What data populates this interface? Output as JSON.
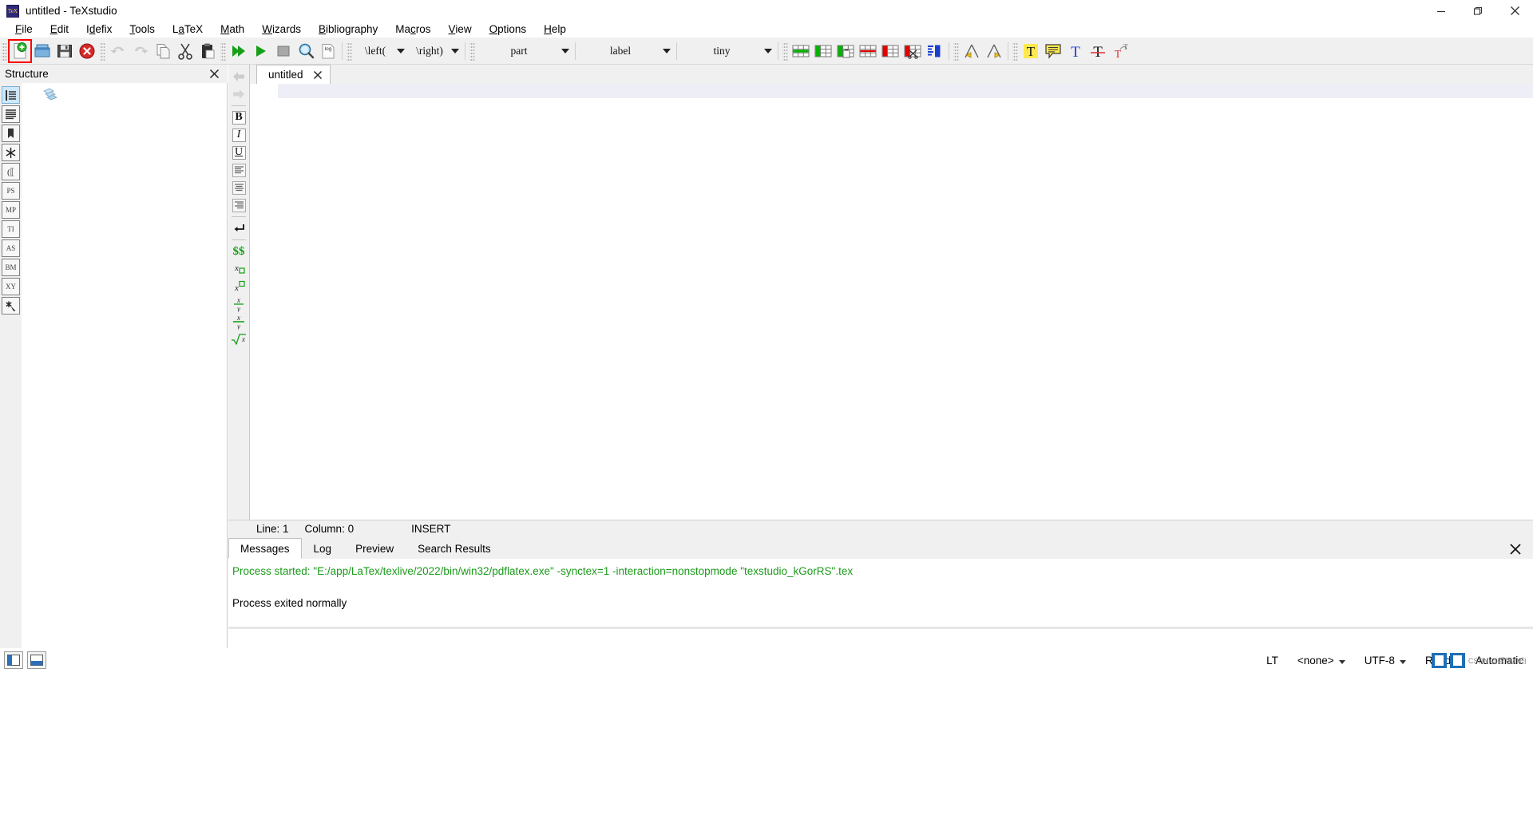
{
  "window": {
    "title": "untitled - TeXstudio",
    "app_icon": "texstudio-icon",
    "minimize_label": "Minimize",
    "maximize_label": "Restore",
    "close_label": "Close"
  },
  "menubar": {
    "items": [
      {
        "label": "File",
        "mnemonic": "F"
      },
      {
        "label": "Edit",
        "mnemonic": "E"
      },
      {
        "label": "Idefix",
        "mnemonic": "d"
      },
      {
        "label": "Tools",
        "mnemonic": "T"
      },
      {
        "label": "LaTeX",
        "mnemonic": "a"
      },
      {
        "label": "Math",
        "mnemonic": "M"
      },
      {
        "label": "Wizards",
        "mnemonic": "W"
      },
      {
        "label": "Bibliography",
        "mnemonic": "B"
      },
      {
        "label": "Macros",
        "mnemonic": "c"
      },
      {
        "label": "View",
        "mnemonic": "V"
      },
      {
        "label": "Options",
        "mnemonic": "O"
      },
      {
        "label": "Help",
        "mnemonic": "H"
      }
    ]
  },
  "toolbar": {
    "file_group": [
      {
        "name": "new-document",
        "tooltip": "New",
        "highlighted": true
      },
      {
        "name": "open-document",
        "tooltip": "Open"
      },
      {
        "name": "save-document",
        "tooltip": "Save"
      },
      {
        "name": "close-document",
        "tooltip": "Close"
      }
    ],
    "edit_group": [
      {
        "name": "undo",
        "tooltip": "Undo",
        "disabled": true
      },
      {
        "name": "redo",
        "tooltip": "Redo",
        "disabled": true
      },
      {
        "name": "copy",
        "tooltip": "Copy"
      },
      {
        "name": "cut",
        "tooltip": "Cut"
      },
      {
        "name": "paste",
        "tooltip": "Paste"
      }
    ],
    "build_group": [
      {
        "name": "build-and-view",
        "tooltip": "Build & View"
      },
      {
        "name": "compile",
        "tooltip": "Compile"
      },
      {
        "name": "stop-compile",
        "tooltip": "Stop"
      },
      {
        "name": "view-pdf",
        "tooltip": "View"
      },
      {
        "name": "view-log",
        "tooltip": "View Log"
      }
    ],
    "combos": [
      {
        "name": "left-delimiter-combo",
        "value": "\\left(",
        "size": "sm"
      },
      {
        "name": "right-delimiter-combo",
        "value": "\\right)",
        "size": "sm"
      },
      {
        "name": "section-combo",
        "value": "part",
        "size": "md"
      },
      {
        "name": "label-combo",
        "value": "label",
        "size": "sm"
      },
      {
        "name": "fontsize-combo",
        "value": "tiny",
        "size": "sm"
      }
    ],
    "table_group": [
      {
        "name": "add-row-icon",
        "tooltip": "Add Row",
        "color": "#00b400"
      },
      {
        "name": "add-column-icon",
        "tooltip": "Add Column",
        "color": "#00b400"
      },
      {
        "name": "paste-column-icon",
        "tooltip": "Paste Column",
        "color": "#00b400"
      },
      {
        "name": "remove-row-icon",
        "tooltip": "Remove Row",
        "color": "#e00000"
      },
      {
        "name": "remove-column-icon",
        "tooltip": "Remove Column",
        "color": "#e00000"
      },
      {
        "name": "cut-column-icon",
        "tooltip": "Cut Column",
        "color": "#e00000"
      },
      {
        "name": "align-columns-icon",
        "tooltip": "Align Columns",
        "color": "#1a3fd0"
      }
    ],
    "nav_group": [
      {
        "name": "previous-change-icon",
        "tooltip": "Previous Change"
      },
      {
        "name": "next-change-icon",
        "tooltip": "Next Change"
      }
    ],
    "markup_group": [
      {
        "name": "highlight-text-icon",
        "tooltip": "Highlight"
      },
      {
        "name": "insert-comment-icon",
        "tooltip": "Comment"
      },
      {
        "name": "text-color-icon",
        "tooltip": "Text Color"
      },
      {
        "name": "strikeout-text-icon",
        "tooltip": "Strike Out"
      },
      {
        "name": "superscript-text-icon",
        "tooltip": "Superscript"
      }
    ]
  },
  "left_strip": {
    "items": [
      {
        "name": "structure-view",
        "label": "",
        "icon": "structure-list-icon",
        "selected": true
      },
      {
        "name": "symbols-all",
        "label": "",
        "icon": "lines-icon"
      },
      {
        "name": "bookmarks",
        "label": "",
        "icon": "bookmark-icon"
      },
      {
        "name": "symbols-misc",
        "label": "✱",
        "icon": "asterisk-icon"
      },
      {
        "name": "symbols-delimiters",
        "label": "(⟦",
        "icon": "delimiters-icon"
      },
      {
        "name": "symbols-ps",
        "label": "PS",
        "icon": "ps-icon"
      },
      {
        "name": "symbols-mp",
        "label": "MP",
        "icon": "mp-icon"
      },
      {
        "name": "symbols-ti",
        "label": "TI",
        "icon": "ti-icon"
      },
      {
        "name": "symbols-as",
        "label": "AS",
        "icon": "as-icon"
      },
      {
        "name": "symbols-bm",
        "label": "BM",
        "icon": "bm-icon"
      },
      {
        "name": "symbols-xy",
        "label": "XY",
        "icon": "xy-icon"
      },
      {
        "name": "symbols-favorites",
        "label": "",
        "icon": "star-cursor-icon"
      }
    ]
  },
  "structure_panel": {
    "title": "Structure",
    "close_label": "✕",
    "root_icon": "documents-stack-icon"
  },
  "vertical_toolbar": {
    "items": [
      {
        "name": "back-arrow-icon",
        "glyph": "←",
        "kind": "arrow",
        "disabled": true
      },
      {
        "name": "forward-arrow-icon",
        "glyph": "→",
        "kind": "arrow",
        "disabled": true
      },
      {
        "name": "bold-button",
        "glyph": "B",
        "kind": "box"
      },
      {
        "name": "italic-button",
        "glyph": "I",
        "kind": "box"
      },
      {
        "name": "underline-button",
        "glyph": "U",
        "kind": "box"
      },
      {
        "name": "align-left-button",
        "glyph": "",
        "kind": "align-left"
      },
      {
        "name": "align-center-button",
        "glyph": "",
        "kind": "align-center"
      },
      {
        "name": "align-right-button",
        "glyph": "",
        "kind": "align-right"
      },
      {
        "name": "newline-button",
        "glyph": "↵",
        "kind": "plain"
      },
      {
        "name": "inline-math-button",
        "glyph": "$$",
        "kind": "math-green"
      },
      {
        "name": "subscript-button",
        "glyph": "x",
        "kind": "subscript"
      },
      {
        "name": "superscript-button",
        "glyph": "x",
        "kind": "superscript"
      },
      {
        "name": "fraction-button",
        "glyph": "",
        "kind": "frac"
      },
      {
        "name": "dfraction-button",
        "glyph": "",
        "kind": "dfrac"
      },
      {
        "name": "sqrt-button",
        "glyph": "√x",
        "kind": "sqrt"
      }
    ]
  },
  "editor": {
    "tab_label": "untitled",
    "tab_close": "✕",
    "content": ""
  },
  "editor_status": {
    "line_label": "Line: 1",
    "column_label": "Column: 0",
    "mode": "INSERT"
  },
  "bottom_panel": {
    "tabs": [
      {
        "label": "Messages",
        "active": true
      },
      {
        "label": "Log",
        "active": false
      },
      {
        "label": "Preview",
        "active": false
      },
      {
        "label": "Search Results",
        "active": false
      }
    ],
    "close_label": "✕",
    "messages": {
      "process_started": "Process started: \"E:/app/LaTex/texlive/2022/bin/win32/pdflatex.exe\" -synctex=1 -interaction=nonstopmode \"texstudio_kGorRS\".tex",
      "process_exited": "Process exited normally"
    }
  },
  "statusbar": {
    "left_buttons": [
      {
        "name": "toggle-structure-panel",
        "icon": "panel-left-icon"
      },
      {
        "name": "toggle-bottom-panel",
        "icon": "panel-bottom-icon"
      }
    ],
    "fields": [
      {
        "name": "language-tool",
        "value": "LT"
      },
      {
        "name": "spellcheck-language",
        "value": "<none>",
        "has_caret": true
      },
      {
        "name": "encoding",
        "value": "UTF-8",
        "has_caret": true
      },
      {
        "name": "ready-state",
        "value": "Ready"
      },
      {
        "name": "line-ending",
        "value": "Automatic"
      }
    ],
    "watermark_text": "CSDN @超级小白"
  },
  "colors": {
    "accent_green": "#1a9a1a",
    "highlight_red": "#ff0000",
    "toolbar_bg": "#f0f0f0",
    "editor_band": "#eeeef6",
    "selection_blue": "#cfe8fb"
  }
}
